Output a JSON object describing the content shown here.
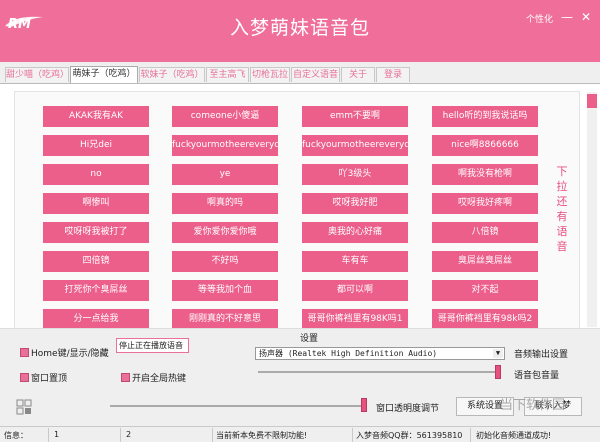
{
  "window": {
    "logo_text": "RM",
    "title": "入梦萌妹语音包",
    "customize": "个性化",
    "min_label": "—",
    "close_label": "✕"
  },
  "tabs": [
    "甜少喵（吃鸡）",
    "萌妹子（吃鸡）",
    "软妹子（吃鸡）",
    "至主高飞",
    "切枪瓦拉",
    "自定义语音",
    "关于",
    "登录"
  ],
  "phrases": [
    "AKAK我有AK",
    "comeone小傻逼",
    "emm不要啊",
    "hello听的到我说话吗",
    "Hi兄dei",
    "fuckyourmotheereverydat",
    "fuckyourmotheereverydat",
    "nice啊8866666",
    "no",
    "ye",
    "吖3级头",
    "啊我没有枪啊",
    "啊惨叫",
    "啊真的吗",
    "哎呀我好肥",
    "哎呀我好疼啊",
    "哎呀呀我被打了",
    "爱你爱你爱你哦",
    "奥我的心好痛",
    "八倍镜",
    "四倍镜",
    "不好吗",
    "车有车",
    "臭屌丝臭屌丝",
    "打死你个臭屌丝",
    "等等我加个血",
    "都可以啊",
    "对不起",
    "分一点给我",
    "刚刚真的不好意思",
    "哥哥你裤裆里有98K吗1",
    "哥哥你裤裆里有98k吗2"
  ],
  "hint": [
    "下",
    "拉",
    "还",
    "有",
    "语",
    "音"
  ],
  "settings": {
    "hotkey_label": "Home键/显示/隐藏",
    "topmost_label": "窗口置顶",
    "global_hotkey_label": "开启全局热键",
    "stop_label": "停止正在播放语音",
    "group_label": "设置",
    "device": "扬声器 (Realtek High Definition Audio)",
    "audio_output_label": "音频输出设置",
    "volume_label": "语音包音量",
    "volume_level": 1.0,
    "opacity_label": "窗口透明度调节",
    "opacity_level": 1.0,
    "system_settings": "系统设置",
    "contact": "联系入梦",
    "watermark": "当下软件园"
  },
  "status": {
    "info_label": "信息：",
    "field1": "1",
    "field2": "2",
    "notice": "当前新本免费不限制功能!",
    "qq": "入梦音频QQ群：561395810",
    "result": "初始化音频通道成功!"
  }
}
